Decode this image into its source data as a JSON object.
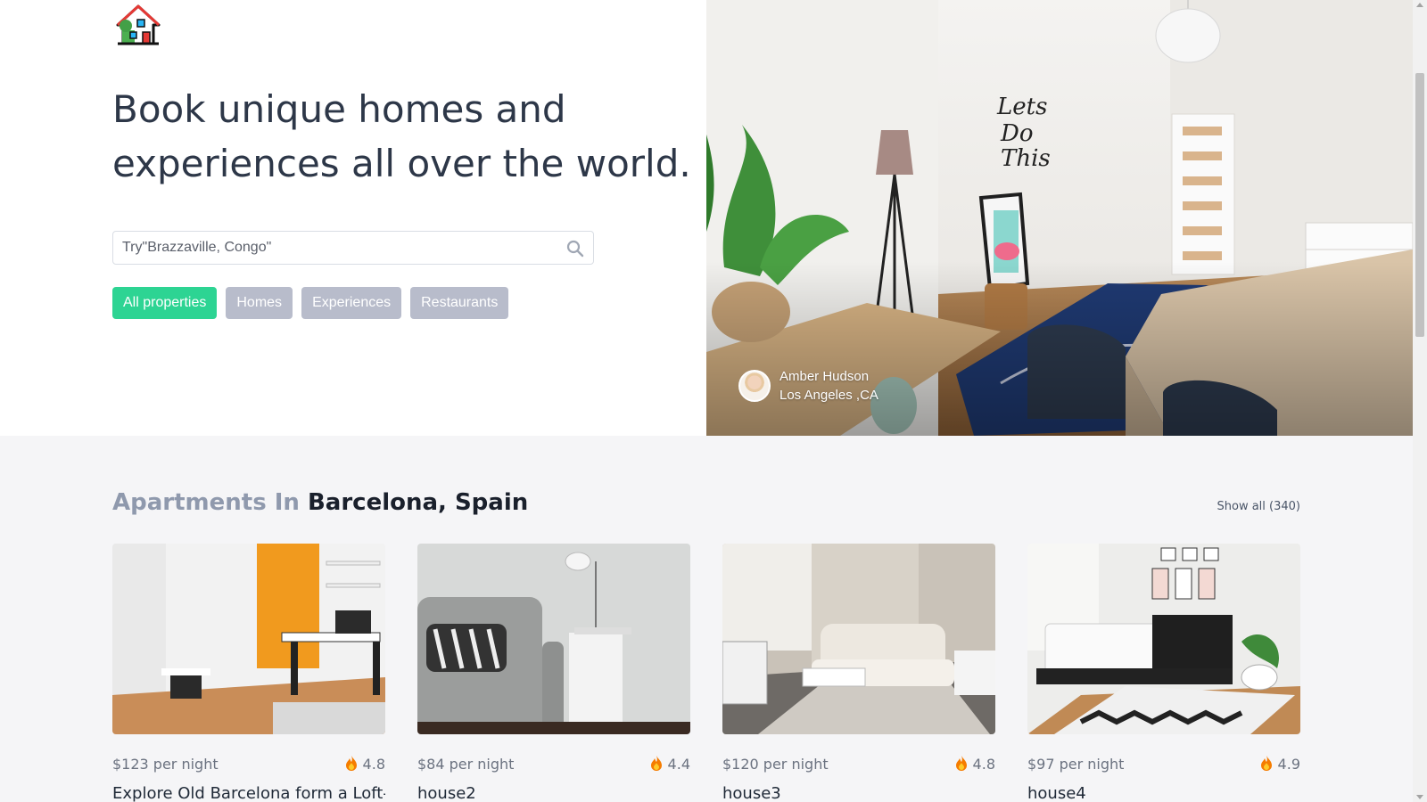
{
  "brand": {
    "logo_icon": "house-logo-icon"
  },
  "hero": {
    "headline_line1": "Book unique homes and",
    "headline_line2": "experiences all over the world.",
    "search": {
      "placeholder": "Try\"Brazzaville, Congo\"",
      "value": ""
    },
    "filters": [
      {
        "label": "All properties",
        "active": true
      },
      {
        "label": "Homes",
        "active": false
      },
      {
        "label": "Experiences",
        "active": false
      },
      {
        "label": "Restaurants",
        "active": false
      }
    ],
    "photo_credit": {
      "name": "Amber Hudson",
      "location": "Los Angeles ,CA"
    }
  },
  "listing": {
    "title_prefix": "Apartments In",
    "title_location": "Barcelona, Spain",
    "show_all": "Show all (340)",
    "cards": [
      {
        "price": "$123 per night",
        "rating": "4.8",
        "title": "Explore Old Barcelona form a Loft-"
      },
      {
        "price": "$84 per night",
        "rating": "4.4",
        "title": "house2"
      },
      {
        "price": "$120 per night",
        "rating": "4.8",
        "title": "house3"
      },
      {
        "price": "$97 per night",
        "rating": "4.9",
        "title": "house4"
      }
    ]
  },
  "colors": {
    "accent": "#2dd493",
    "chip_inactive": "#b8bccb",
    "section_bg": "#f5f5f7",
    "heading": "#2d3748",
    "muted_heading": "#8f99ad"
  }
}
